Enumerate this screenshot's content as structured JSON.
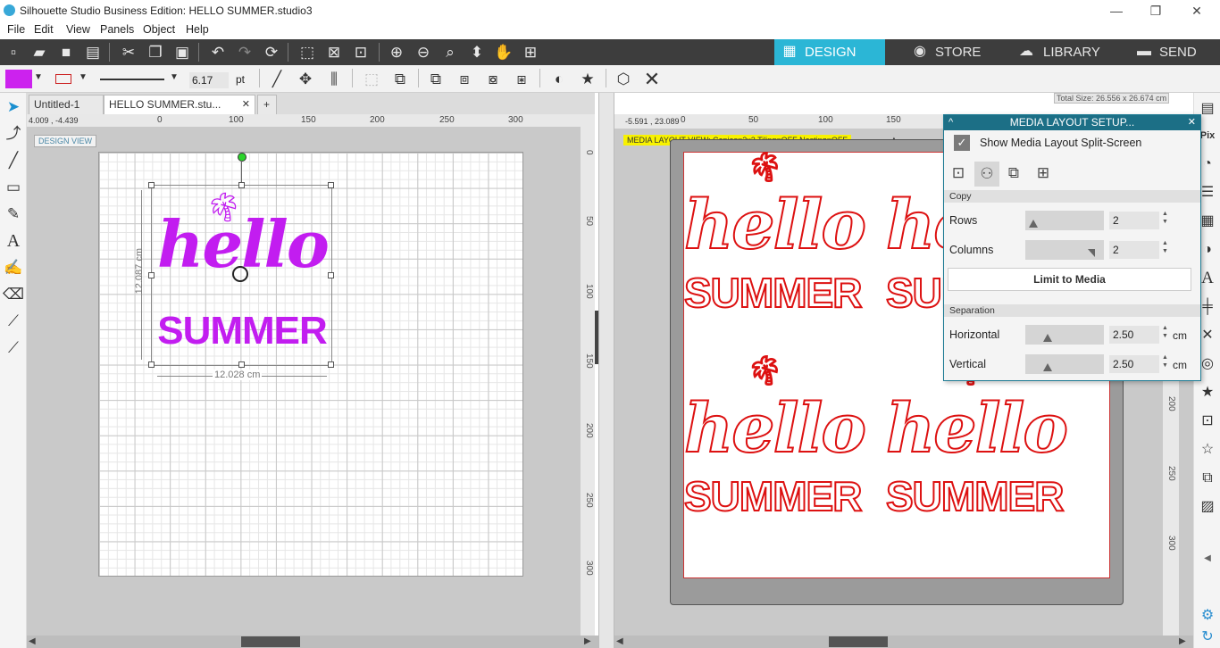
{
  "window": {
    "title": "Silhouette Studio Business Edition: HELLO SUMMER.studio3",
    "minimize": "—",
    "restore": "❐",
    "close": "✕"
  },
  "menu": [
    "File",
    "Edit",
    "View",
    "Panels",
    "Object",
    "Help"
  ],
  "nav": {
    "design": "DESIGN",
    "store": "STORE",
    "library": "LIBRARY",
    "send": "SEND",
    "active_color": "#2bb6d6"
  },
  "props": {
    "fill_color": "#cc22ee",
    "line_width": "6.17",
    "line_unit": "pt"
  },
  "tabs": [
    {
      "label": "Untitled-1"
    },
    {
      "label": "HELLO SUMMER.stu..."
    },
    {
      "label": "+"
    }
  ],
  "left_view": {
    "badge": "DESIGN VIEW",
    "coords": "4.009 , -4.439",
    "ruler_top": [
      "50",
      "0",
      "50",
      "100",
      "150",
      "200",
      "250",
      "300"
    ],
    "ruler_right": [
      "0",
      "50",
      "100",
      "150",
      "200",
      "250",
      "300"
    ],
    "design_line1": "hello",
    "design_line2": "SUMMER",
    "height_label": "12.087 cm",
    "width_label": "12.028 cm",
    "design_color": "#c21df0"
  },
  "right_view": {
    "coords": "-5.591 , 23.089",
    "banner": "MEDIA LAYOUT VIEW:  Copies=2x2  Tiling=OFF  Nesting=OFF",
    "total_size": "Total Size: 26.556 x 26.674 cm",
    "ruler_top": [
      "0",
      "50",
      "100",
      "150"
    ],
    "ruler_right": [
      "50",
      "100",
      "150",
      "200",
      "250",
      "300"
    ],
    "copy_line1": "hello",
    "copy_line2": "SUMMER",
    "copy_color": "#dd1111"
  },
  "panel": {
    "title": "MEDIA LAYOUT SETUP...",
    "show_split": "Show Media Layout Split-Screen",
    "copy_section": "Copy",
    "rows_label": "Rows",
    "rows_value": "2",
    "columns_label": "Columns",
    "columns_value": "2",
    "limit_button": "Limit to Media",
    "separation_section": "Separation",
    "horizontal_label": "Horizontal",
    "horizontal_value": "2.50",
    "vertical_label": "Vertical",
    "vertical_value": "2.50",
    "unit": "cm",
    "close": "✕",
    "collapse": "^"
  }
}
